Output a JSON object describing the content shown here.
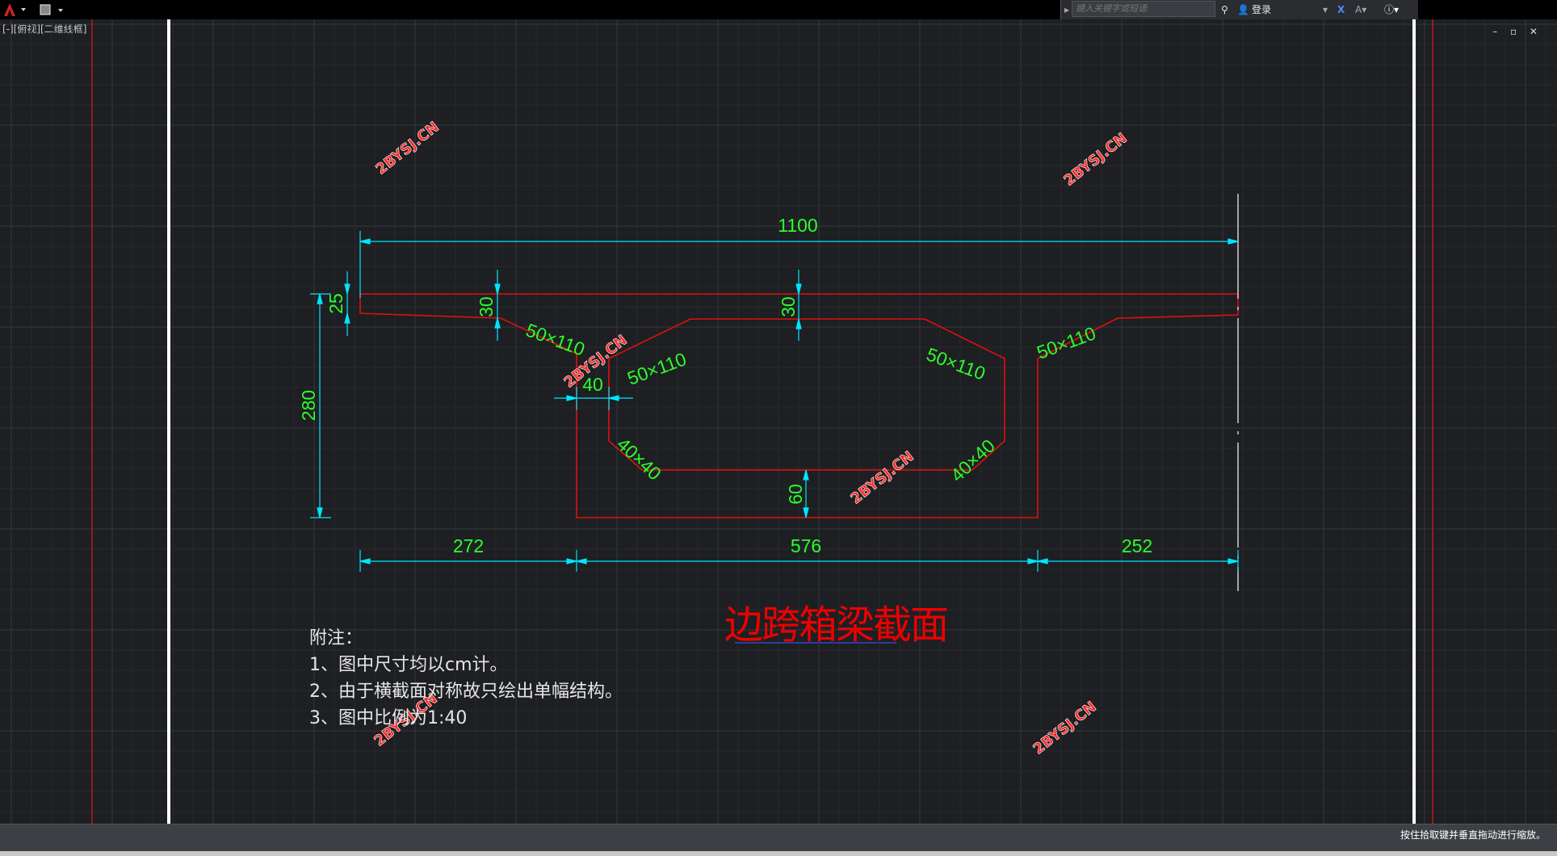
{
  "app": {
    "search_placeholder": "键入关键字或短语",
    "login_label": "登录",
    "view_label": "[-][俯视][二维线框]",
    "window_controls": "– ▫ ✕",
    "status_text": "按住拾取键并垂直拖动进行缩放。"
  },
  "drawing": {
    "title": "边跨箱梁截面",
    "watermark": "2BYSJ.CN",
    "notes": [
      "附注：",
      "1、图中尺寸均以cm计。",
      "2、由于横截面对称故只绘出单幅结构。",
      "3、图中比例为1:40"
    ],
    "dimensions": {
      "overall_width": "1100",
      "left_cantilever": "272",
      "box_width": "576",
      "right_part": "252",
      "height": "280",
      "cantilever_tip": "25",
      "top_slab_left": "30",
      "top_slab_center": "30",
      "bottom_slab": "60",
      "web": "40",
      "haunch_outer_left": "50×110",
      "haunch_inner_left": "50×110",
      "haunch_inner_right": "50×110",
      "haunch_outer_right": "50×110",
      "fillet_left": "40×40",
      "fillet_right": "40×40"
    }
  },
  "colors": {
    "background": "#1d1f22",
    "grid": "#2b2e33",
    "outline": "#e01010",
    "dimension_line": "#00e5ff",
    "dimension_text": "#2cff2c",
    "watermark": "#ff2a2a"
  }
}
